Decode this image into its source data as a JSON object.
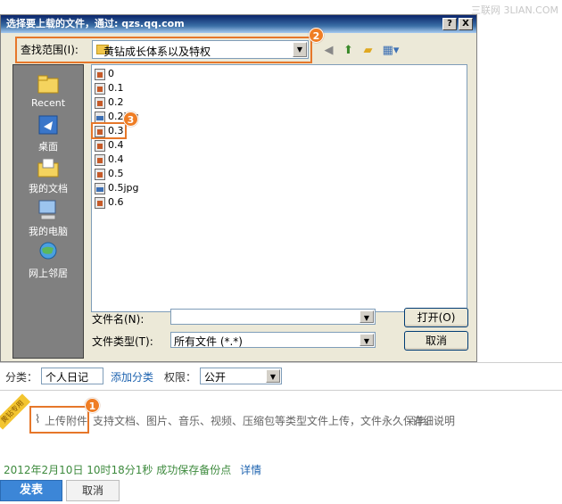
{
  "watermark": "三联网 3LIAN.COM",
  "dialog": {
    "title": "选择要上载的文件，通过: qzs.qq.com",
    "help_button": "?",
    "close_button": "X",
    "look_in_label": "查找范围(I):",
    "look_in_value": "黄钻成长体系以及特权",
    "places": [
      {
        "label": "Recent",
        "icon": "recent-folder-icon"
      },
      {
        "label": "桌面",
        "icon": "desktop-icon"
      },
      {
        "label": "我的文档",
        "icon": "my-documents-icon"
      },
      {
        "label": "我的电脑",
        "icon": "my-computer-icon"
      },
      {
        "label": "网上邻居",
        "icon": "network-icon"
      }
    ],
    "files": [
      {
        "name": "0",
        "type": "doc"
      },
      {
        "name": "0.1",
        "type": "doc"
      },
      {
        "name": "0.2",
        "type": "doc"
      },
      {
        "name": "0.2jpg",
        "type": "img"
      },
      {
        "name": "0.3",
        "type": "doc"
      },
      {
        "name": "0.4",
        "type": "doc"
      },
      {
        "name": "0.4",
        "type": "doc"
      },
      {
        "name": "0.5",
        "type": "doc"
      },
      {
        "name": "0.5jpg",
        "type": "img"
      },
      {
        "name": "0.6",
        "type": "doc"
      }
    ],
    "filename_label": "文件名(N):",
    "filename_value": "",
    "filetype_label": "文件类型(T):",
    "filetype_value": "所有文件 (*.*)",
    "open_button": "打开(O)",
    "cancel_button": "取消"
  },
  "badges": {
    "one": "1",
    "two": "2",
    "three": "3"
  },
  "page": {
    "category_label": "分类：",
    "category_value": "个人日记",
    "add_category_link": "添加分类",
    "permission_label": "权限：",
    "permission_value": "公开",
    "corner_tag": "黄钻专用",
    "upload_link": "上传附件",
    "upload_desc": "支持文档、图片、音乐、视频、压缩包等类型文件上传，文件永久保存。",
    "details_link": "详细说明",
    "status_text": "2012年2月10日 10时18分1秒 成功保存备份点",
    "status_details_link": "详情",
    "publish_button": "发表",
    "cancel_button": "取消"
  },
  "colors": {
    "highlight": "#e6772a",
    "badge": "#ef7d24",
    "link": "#1f64b0",
    "publish": "#3c86d7"
  }
}
